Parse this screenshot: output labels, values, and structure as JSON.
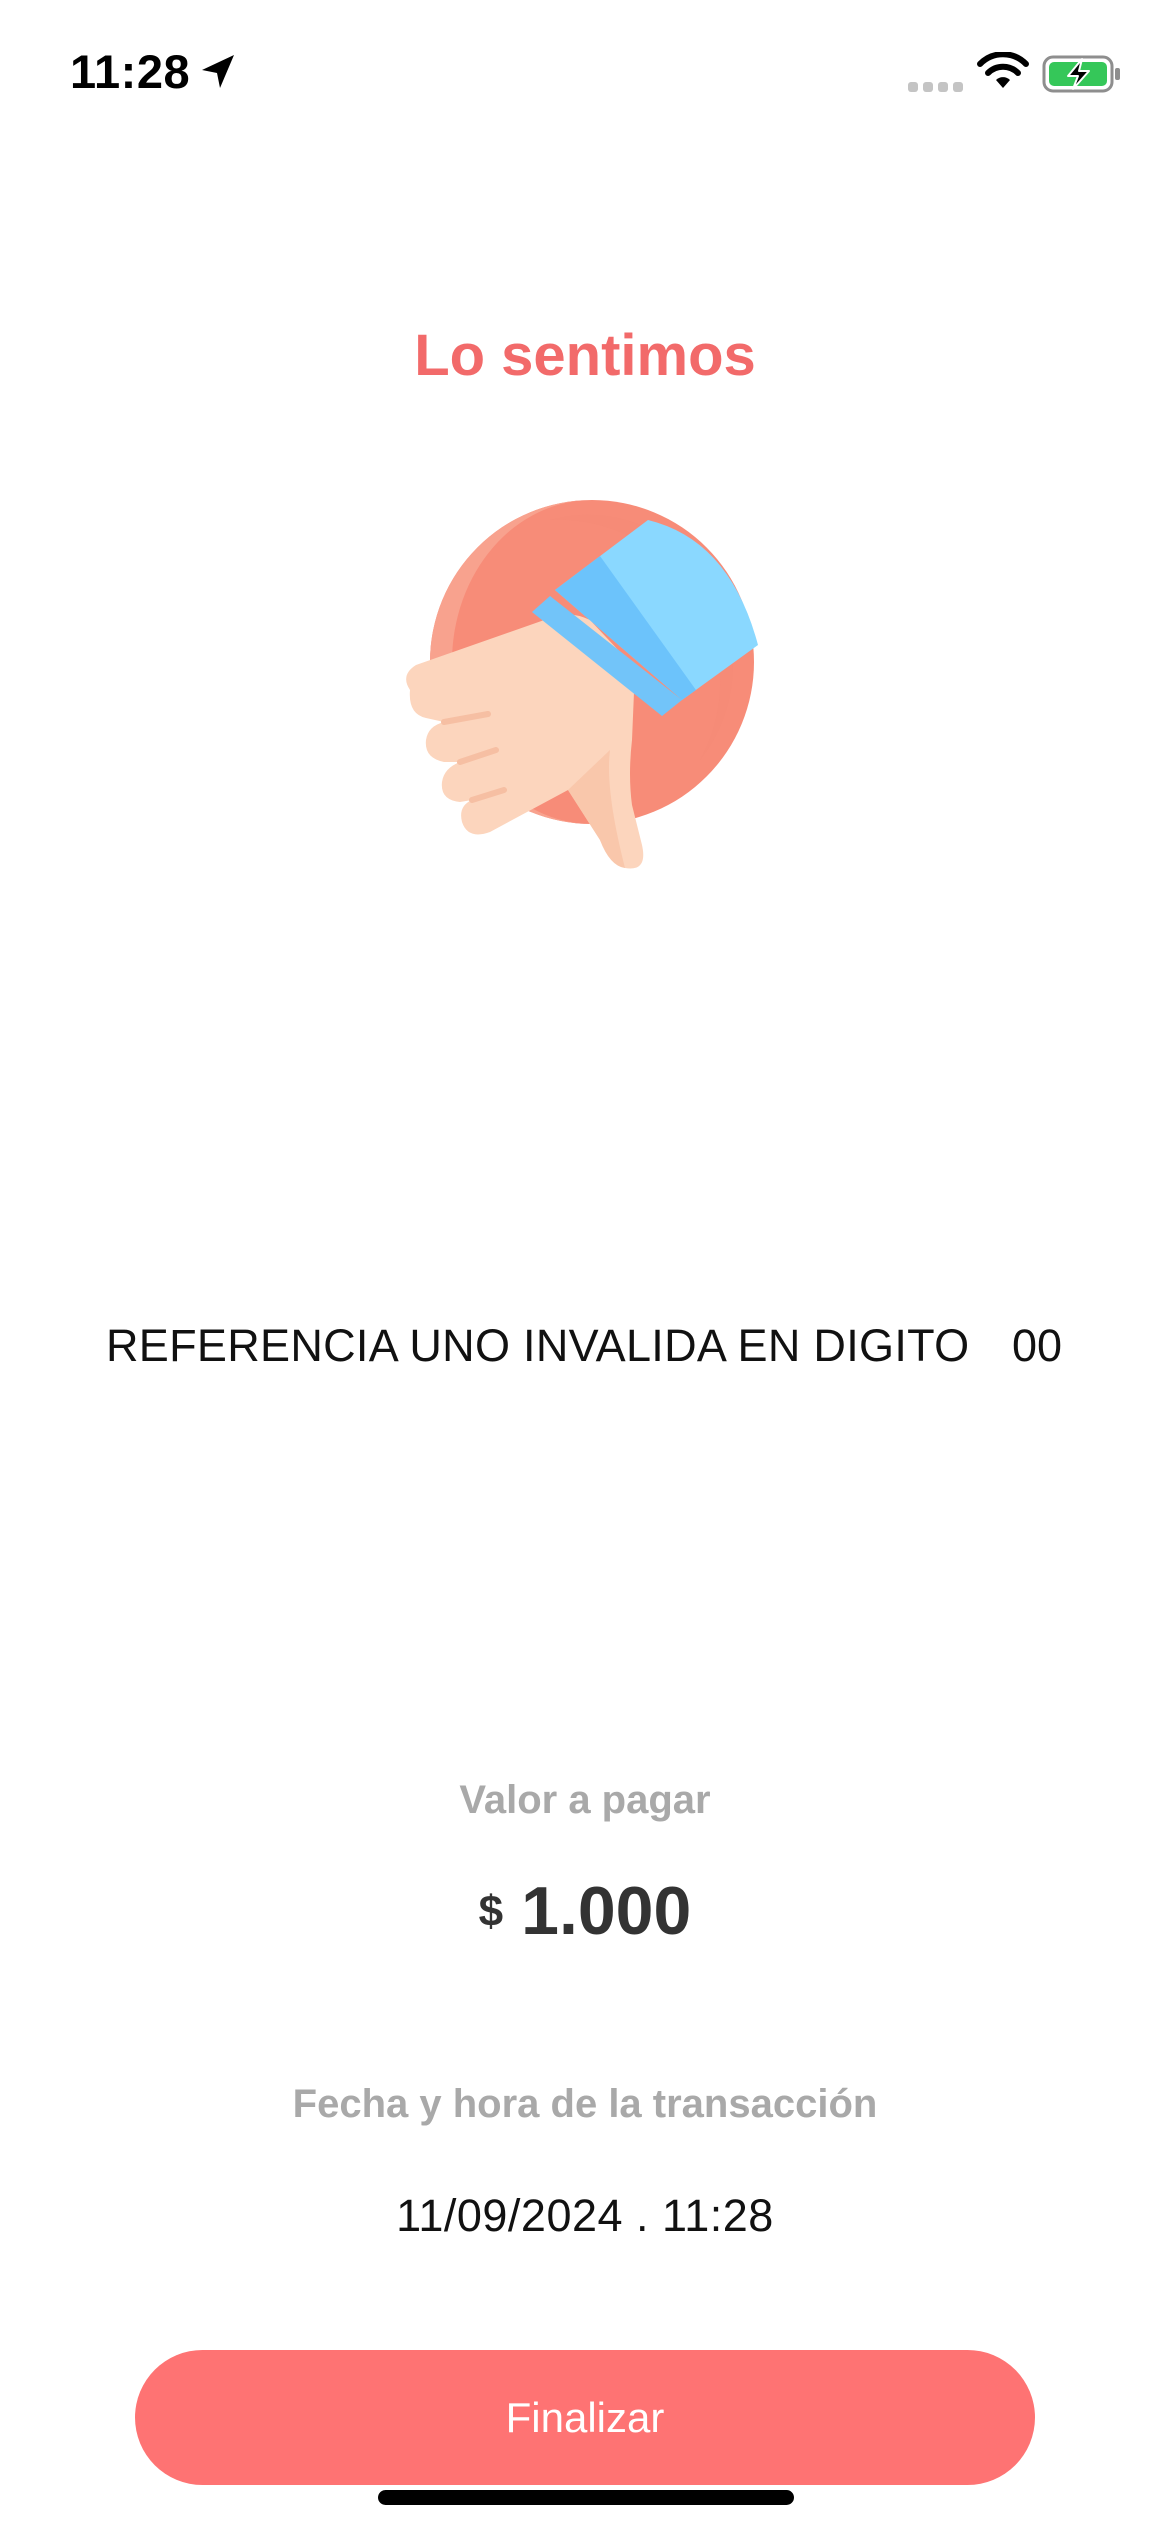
{
  "status_bar": {
    "time": "11:28"
  },
  "screen": {
    "title": "Lo sentimos",
    "illustration_icon": "thumbs-down-icon",
    "message": "REFERENCIA UNO INVALIDA EN DIGITO",
    "message_code": "00",
    "amount_label": "Valor a pagar",
    "currency_symbol": "$",
    "amount": "1.000",
    "datetime_label": "Fecha y hora de la transacción",
    "datetime": "11/09/2024 . 11:28"
  },
  "actions": {
    "finish_label": "Finalizar"
  },
  "colors": {
    "accent": "#f26a6a",
    "button": "#fe7373",
    "muted_text": "#a9a9a9"
  }
}
